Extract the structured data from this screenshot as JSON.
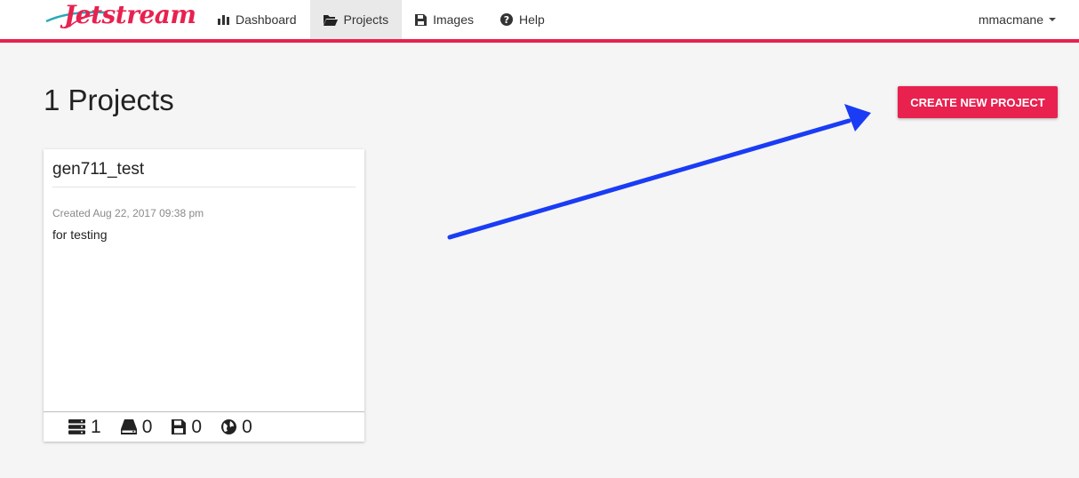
{
  "header": {
    "logo_text": "Jetstream",
    "nav": [
      {
        "label": "Dashboard",
        "icon": "bar-chart-icon",
        "active": false
      },
      {
        "label": "Projects",
        "icon": "folder-open-icon",
        "active": true
      },
      {
        "label": "Images",
        "icon": "floppy-disk-icon",
        "active": false
      },
      {
        "label": "Help",
        "icon": "question-circle-icon",
        "active": false
      }
    ],
    "username": "mmacmane"
  },
  "main": {
    "title": "1 Projects",
    "create_button": "CREATE NEW PROJECT"
  },
  "projects": [
    {
      "name": "gen711_test",
      "created": "Created Aug 22, 2017 09:38 pm",
      "description": "for testing",
      "stats": [
        {
          "icon": "server-stack-icon",
          "count": "1"
        },
        {
          "icon": "hard-drive-icon",
          "count": "0"
        },
        {
          "icon": "floppy-disk-icon",
          "count": "0"
        },
        {
          "icon": "globe-icon",
          "count": "0"
        }
      ]
    }
  ],
  "colors": {
    "accent": "#e8214f",
    "annotation_arrow": "#1a3cf5"
  }
}
